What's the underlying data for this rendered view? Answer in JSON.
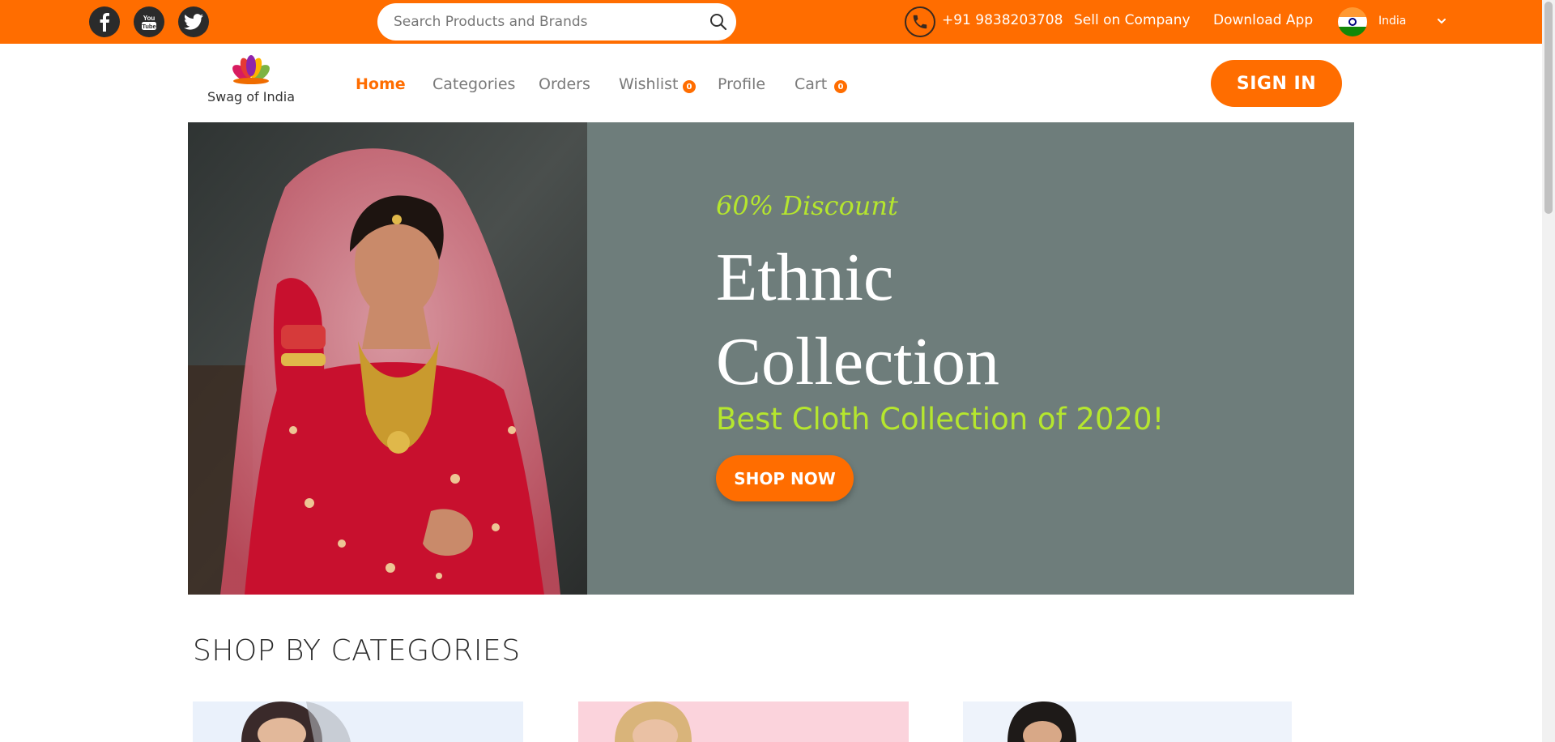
{
  "topbar": {
    "social": [
      {
        "name": "facebook-icon"
      },
      {
        "name": "youtube-icon",
        "text": "You Tube"
      },
      {
        "name": "twitter-icon"
      }
    ],
    "search": {
      "placeholder": "Search Products and Brands"
    },
    "phone": "+91 9838203708",
    "sell": "Sell on Company",
    "download": "Download App",
    "country": "India",
    "bg_color": "#ff6d00"
  },
  "header": {
    "logo_text": "Swag of India",
    "nav": [
      {
        "label": "Home",
        "active": true
      },
      {
        "label": "Categories"
      },
      {
        "label": "Orders"
      },
      {
        "label": "Wishlist",
        "badge": "0"
      },
      {
        "label": "Profile"
      },
      {
        "label": "Cart",
        "badge": "0"
      }
    ],
    "signin": "SIGN IN"
  },
  "hero": {
    "discount": "60% Discount",
    "title_line1": "Ethnic",
    "title_line2": "Collection",
    "subtitle": "Best Cloth Collection of 2020!",
    "cta": "SHOP NOW",
    "bg_color": "#6e7d7b",
    "accent_color": "#b5e62e"
  },
  "categories": {
    "heading": "SHOP BY CATEGORIES",
    "cards": [
      {
        "bg": "#eaf1fb"
      },
      {
        "bg": "#fbd3dc"
      },
      {
        "bg": "#eef3fb"
      }
    ]
  }
}
